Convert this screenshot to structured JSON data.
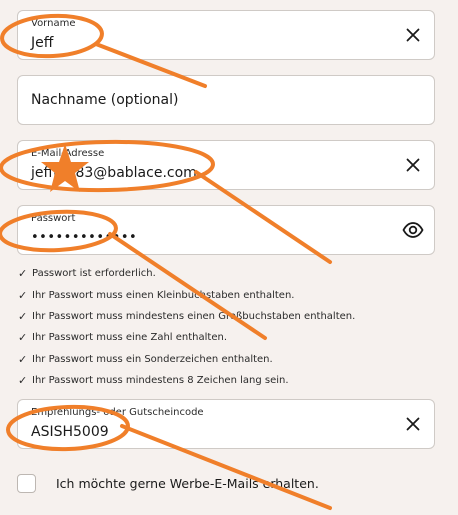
{
  "colors": {
    "background": "#f6f1ee",
    "field_bg": "#ffffff",
    "annotation": "#f07f2a"
  },
  "form": {
    "first_name": {
      "label": "Vorname",
      "value": "Jeff",
      "icon": "close-icon"
    },
    "last_name": {
      "placeholder": "Nachname (optional)"
    },
    "email": {
      "label": "E-Mail-Adresse",
      "value": "jeffrey83@bablace.com",
      "icon": "close-icon"
    },
    "password": {
      "label": "Passwort",
      "value": "•••••••••••••",
      "icon": "eye-icon"
    },
    "password_rules": [
      "Passwort ist erforderlich.",
      "Ihr Passwort muss einen Kleinbuchstaben enthalten.",
      "Ihr Passwort muss mindestens einen Großbuchstaben enthalten.",
      "Ihr Passwort muss eine Zahl enthalten.",
      "Ihr Passwort muss ein Sonderzeichen enthalten.",
      "Ihr Passwort muss mindestens 8 Zeichen lang sein."
    ],
    "rule_check_glyph": "✓",
    "referral": {
      "label": "Empfehlungs- oder Gutscheincode",
      "value": "ASISH5009",
      "icon": "close-icon"
    },
    "newsletter": {
      "label": "Ich möchte gerne Werbe-E-Mails erhalten.",
      "checked": false
    }
  }
}
